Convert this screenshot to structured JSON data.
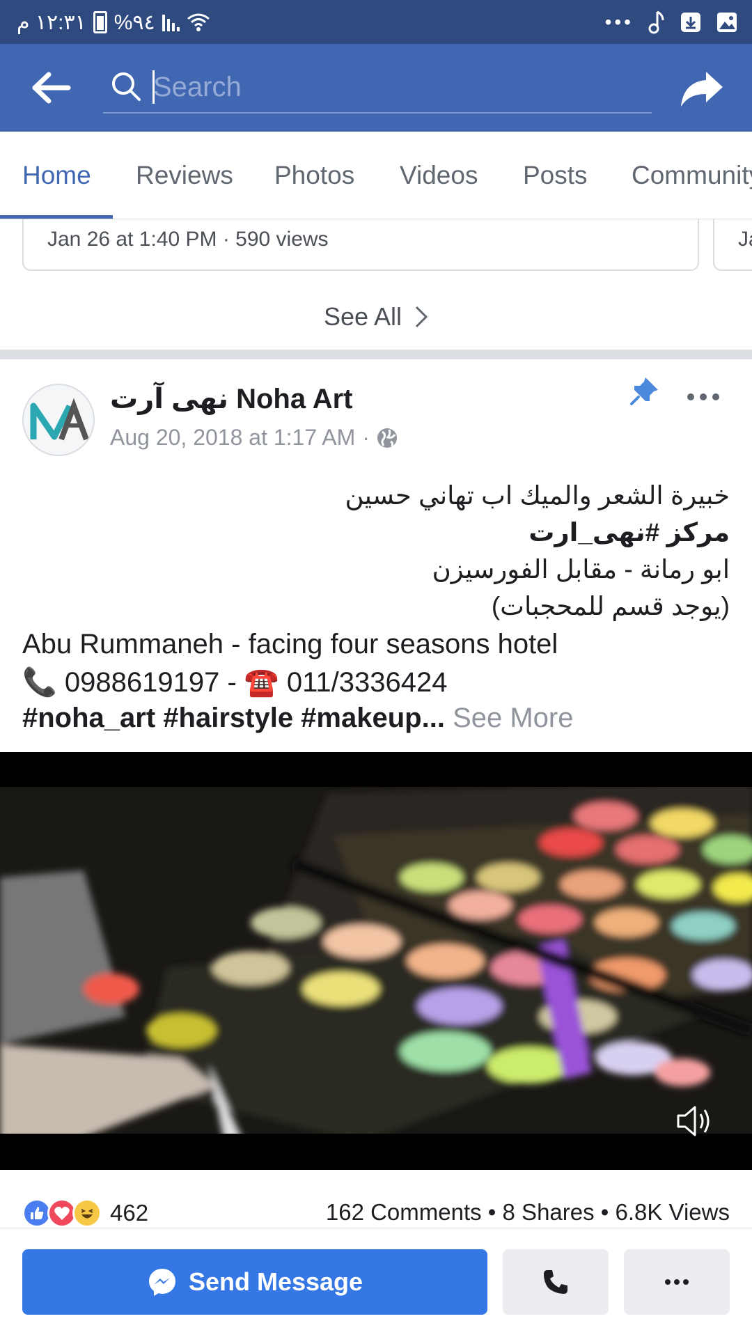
{
  "status_bar": {
    "time": "١٢:٣١ م",
    "battery": "%٩٤"
  },
  "search": {
    "placeholder": "Search"
  },
  "tabs": [
    "Home",
    "Reviews",
    "Photos",
    "Videos",
    "Posts",
    "Community"
  ],
  "active_tab": "Home",
  "video_card": {
    "meta": "Jan 26 at 1:40 PM · 590 views",
    "next_card_meta": "Ja"
  },
  "see_all": "See All",
  "post": {
    "page_name": "نهى آرت Noha Art",
    "date": "Aug 20, 2018 at 1:17 AM",
    "lines_ar": [
      "خبيرة الشعر والميك اب تهاني حسين",
      "مركز #نهى_ارت",
      "ابو رمانة - مقابل الفورسيزن",
      "(يوجد قسم للمحجبات)"
    ],
    "line_en": "Abu Rummaneh - facing four seasons hotel",
    "phones": "📞 0988619197 - ☎️ 011/3336424",
    "hashtags": "#noha_art #hairstyle #makeup",
    "ellipsis": "...",
    "see_more": "See More"
  },
  "engagement": {
    "reactions_count": "462",
    "stats": "162 Comments • 8 Shares • 6.8K Views"
  },
  "actions": {
    "send_message": "Send Message"
  },
  "colors": {
    "status_bar": "#2f4a7f",
    "top_bar": "#4267b2",
    "send_button": "#3578e5",
    "muted_text": "#90949c"
  }
}
